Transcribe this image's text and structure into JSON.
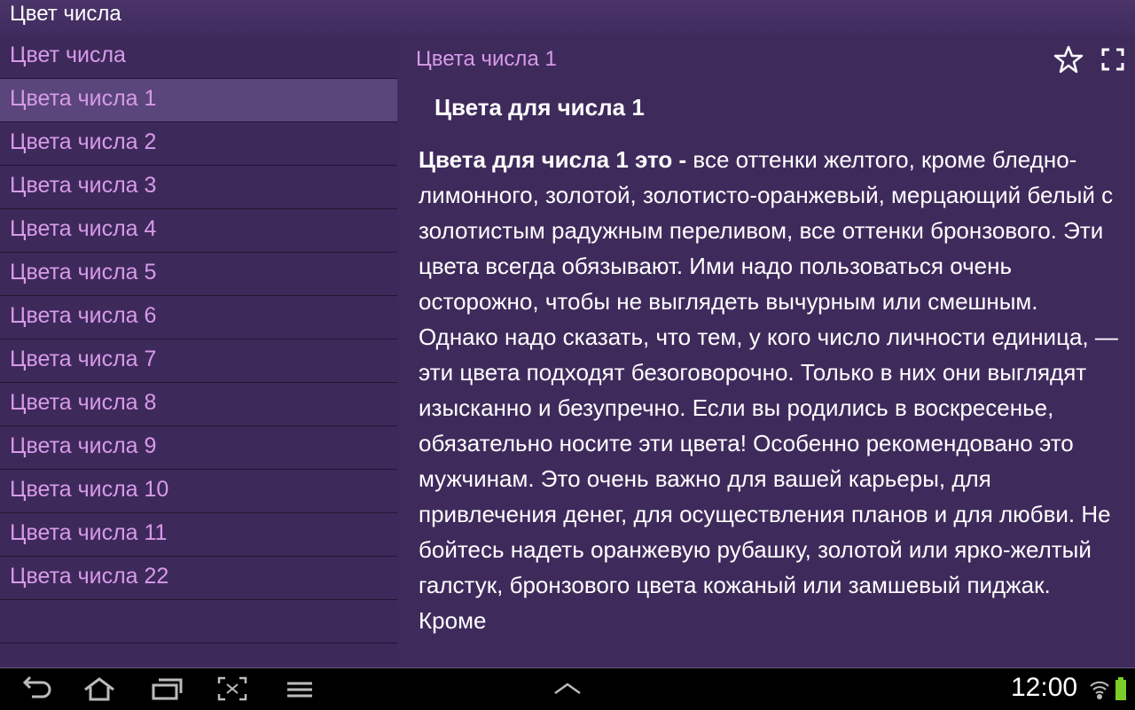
{
  "app": {
    "title": "Цвет числа"
  },
  "sidebar": {
    "header": "Цвет числа",
    "items": [
      "Цвета числа 1",
      "Цвета числа 2",
      "Цвета числа 3",
      "Цвета числа 4",
      "Цвета числа 5",
      "Цвета числа 6",
      "Цвета числа 7",
      "Цвета числа 8",
      "Цвета числа 9",
      "Цвета числа 10",
      "Цвета числа 11",
      "Цвета числа 22"
    ],
    "selected_index": 0
  },
  "content": {
    "title": "Цвета числа 1",
    "heading": "Цвета для числа 1",
    "lead_bold": "Цвета для числа 1 это -",
    "body": "все оттенки желтого, кроме бледно-лимонного, золотой, золотисто-оранжевый, мерцающий белый с золотистым радужным переливом, все оттенки бронзового. Эти цвета всегда обязывают. Ими надо пользоваться очень осторожно, чтобы не выглядеть вычурным или смешным. Однако надо сказать, что тем, у кого число личности единица, — эти цвета подходят безоговорочно. Только в них они выглядят изысканно и безупречно. Если вы родились в воскресенье, обязательно носите эти цвета! Особенно рекомендовано это мужчинам. Это очень важно для вашей карьеры, для привлечения денег, для осуществления планов и для любви. Не бойтесь надеть оранжевую рубашку, золотой или ярко-желтый галстук, бронзового цвета кожаный или замшевый пиджак. Кроме"
  },
  "statusbar": {
    "time": "12:00"
  },
  "icons": {
    "favorite": "star-icon",
    "fullscreen": "fullscreen-icon",
    "back": "back-icon",
    "home": "home-icon",
    "recent": "recent-apps-icon",
    "screenshot": "screenshot-icon",
    "menu": "menu-icon",
    "up": "chevron-up-icon",
    "wifi": "wifi-icon",
    "battery": "battery-icon"
  },
  "colors": {
    "background": "#3f2a5c",
    "accent_text": "#d79be8",
    "selected_item": "#5a467b",
    "battery": "#7ccc2a"
  }
}
